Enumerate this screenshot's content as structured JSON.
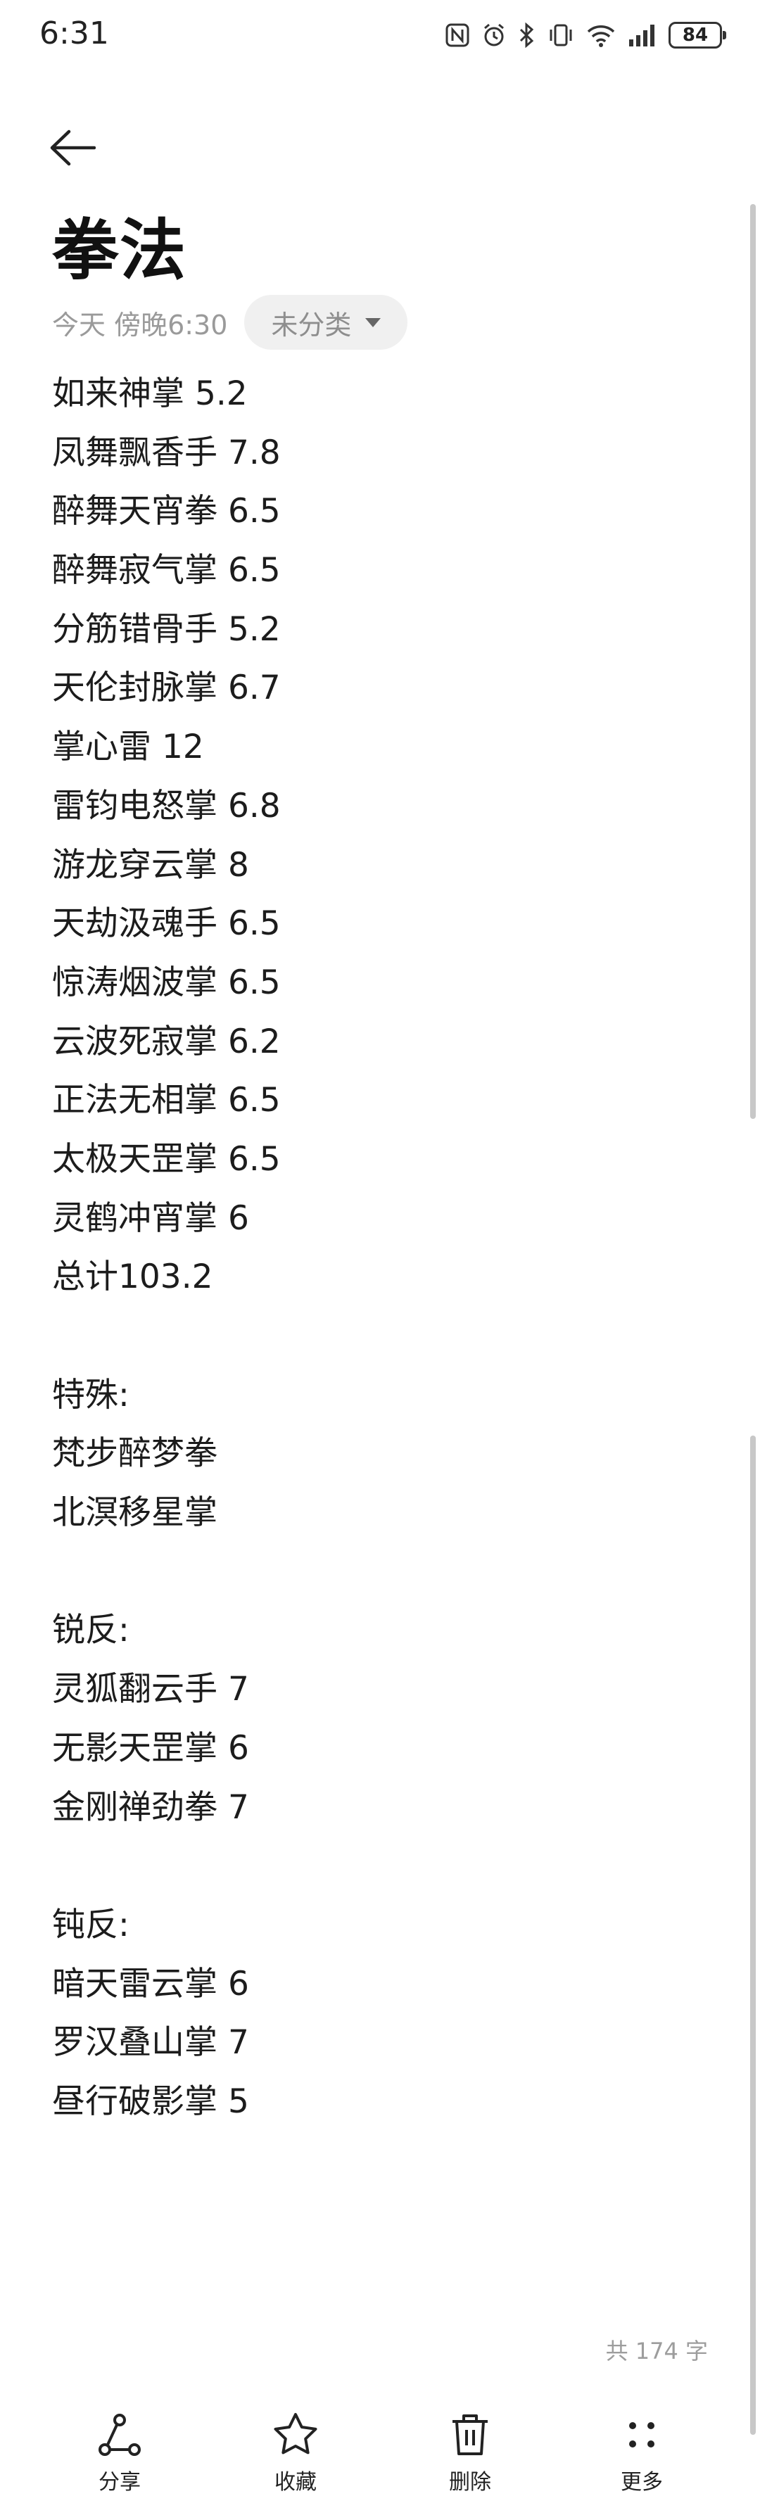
{
  "status_bar": {
    "time": "6:31",
    "battery": "84",
    "icons": [
      "nfc-icon",
      "alarm-icon",
      "bluetooth-icon",
      "vibrate-icon",
      "wifi-icon",
      "signal-icon",
      "battery-icon"
    ]
  },
  "header": {
    "title": "拳法",
    "date": "今天 傍晚6:30",
    "category": "未分类"
  },
  "note": {
    "lines": [
      "如来神掌 5.2",
      "凤舞飘香手 7.8",
      "醉舞天宵拳 6.5",
      "醉舞寂气掌 6.5",
      "分筋错骨手 5.2",
      "天伦封脉掌 6.7",
      "掌心雷 12",
      "雷钧电怒掌 6.8",
      "游龙穿云掌 8",
      "天劫汲魂手 6.5",
      "惊涛烟波掌 6.5",
      "云波死寂掌 6.2",
      "正法无相掌 6.5",
      "太极天罡掌 6.5",
      "灵鹤冲宵掌 6",
      "总计103.2",
      "",
      "特殊:",
      "梵步醉梦拳",
      "北溟移星掌",
      "",
      "锐反:",
      "灵狐翻云手 7",
      "无影天罡掌 6",
      "金刚禅劲拳 7",
      "",
      "钝反:",
      "暗天雷云掌 6",
      "罗汉叠山掌 7",
      "昼行破影掌 5"
    ]
  },
  "word_count": "共 174 字",
  "toolbar": {
    "share": "分享",
    "favorite": "收藏",
    "delete": "删除",
    "more": "更多"
  }
}
